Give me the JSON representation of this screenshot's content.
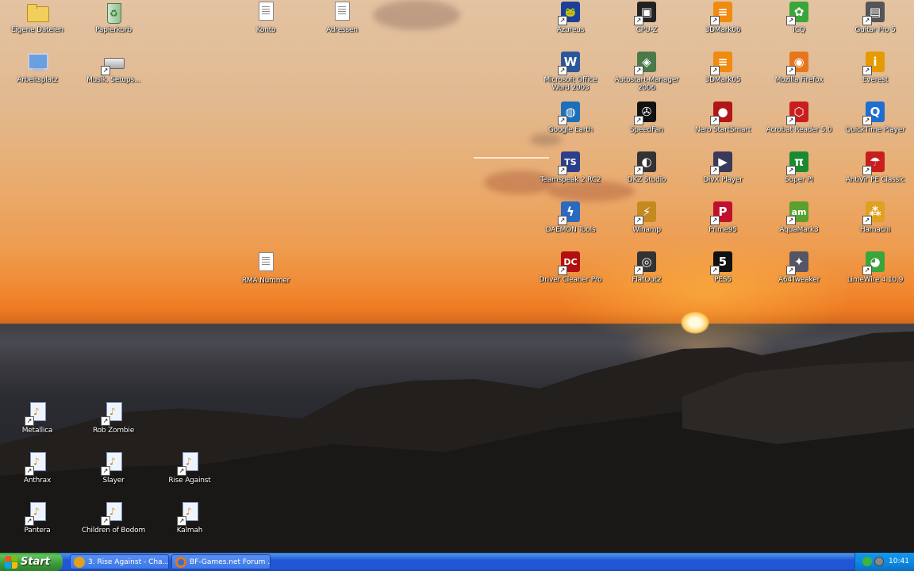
{
  "desktop": {
    "icons": [
      {
        "label": "Eigene Dateien",
        "icon": "my-documents-folder-icon"
      },
      {
        "label": "Papierkorb",
        "icon": "recycle-bin-icon"
      },
      {
        "label": "Konto",
        "icon": "text-document-icon"
      },
      {
        "label": "Adressen",
        "icon": "text-document-icon"
      },
      {
        "label": "Arbeitsplatz",
        "icon": "my-computer-icon"
      },
      {
        "label": "Musik, Setups...",
        "icon": "drive-icon"
      },
      {
        "label": "RMA Nummer",
        "icon": "text-document-icon"
      },
      {
        "label": "Azureus",
        "icon": "azureus-frog-icon"
      },
      {
        "label": "CPU-Z",
        "icon": "cpu-chip-icon"
      },
      {
        "label": "3DMark06",
        "icon": "3dmark-icon"
      },
      {
        "label": "ICQ",
        "icon": "icq-flower-icon"
      },
      {
        "label": "Guitar Pro 5",
        "icon": "guitar-pro-icon"
      },
      {
        "label": "Microsoft Office Word 2003",
        "icon": "word-icon"
      },
      {
        "label": "Autostart-Manager 2006",
        "icon": "autostart-manager-icon"
      },
      {
        "label": "3DMark05",
        "icon": "3dmark-icon"
      },
      {
        "label": "Mozilla Firefox",
        "icon": "firefox-icon"
      },
      {
        "label": "Everest",
        "icon": "everest-info-icon"
      },
      {
        "label": "Google Earth",
        "icon": "google-earth-icon"
      },
      {
        "label": "SpeedFan",
        "icon": "speedfan-icon"
      },
      {
        "label": "Nero StartSmart",
        "icon": "nero-icon"
      },
      {
        "label": "Acrobat Reader 5.0",
        "icon": "acrobat-icon"
      },
      {
        "label": "QuickTime Player",
        "icon": "quicktime-icon"
      },
      {
        "label": "Teamspeak 2 RC2",
        "icon": "teamspeak-icon"
      },
      {
        "label": "DKZ Studio",
        "icon": "dkz-studio-icon"
      },
      {
        "label": "DivX Player",
        "icon": "divx-icon"
      },
      {
        "label": "Super PI",
        "icon": "super-pi-icon"
      },
      {
        "label": "AntiVir PE Classic",
        "icon": "antivir-umbrella-icon"
      },
      {
        "label": "DAEMON Tools",
        "icon": "daemon-tools-icon"
      },
      {
        "label": "Winamp",
        "icon": "winamp-icon"
      },
      {
        "label": "Prime95",
        "icon": "prime95-icon"
      },
      {
        "label": "AquaMark3",
        "icon": "aquamark-icon"
      },
      {
        "label": "Hamachi",
        "icon": "hamachi-icon"
      },
      {
        "label": "Driver Cleaner Pro",
        "icon": "driver-cleaner-icon"
      },
      {
        "label": "FlatOut2",
        "icon": "flatout-icon"
      },
      {
        "label": "PES5",
        "icon": "pes5-icon"
      },
      {
        "label": "A64Tweaker",
        "icon": "a64tweaker-icon"
      },
      {
        "label": "LimeWire 4.10.9",
        "icon": "limewire-icon"
      },
      {
        "label": "Metallica",
        "icon": "music-playlist-icon"
      },
      {
        "label": "Rob Zombie",
        "icon": "music-playlist-icon"
      },
      {
        "label": "Anthrax",
        "icon": "music-playlist-icon"
      },
      {
        "label": "Slayer",
        "icon": "music-playlist-icon"
      },
      {
        "label": "Rise Against",
        "icon": "music-playlist-icon"
      },
      {
        "label": "Pantera",
        "icon": "music-playlist-icon"
      },
      {
        "label": "Children of Bodom",
        "icon": "music-playlist-icon"
      },
      {
        "label": "Kalmah",
        "icon": "music-playlist-icon"
      }
    ]
  },
  "taskbar": {
    "start_label": "Start",
    "tasks": [
      {
        "label": "3. Rise Against - Cha...",
        "icon": "winamp-icon"
      },
      {
        "label": "BF-Games.net Forum ...",
        "icon": "firefox-icon"
      }
    ],
    "clock": "10:41"
  },
  "colors": {
    "taskbar_blue": "#2157d7",
    "start_green": "#3c9a3c",
    "tray_blue": "#0f8ae0"
  }
}
